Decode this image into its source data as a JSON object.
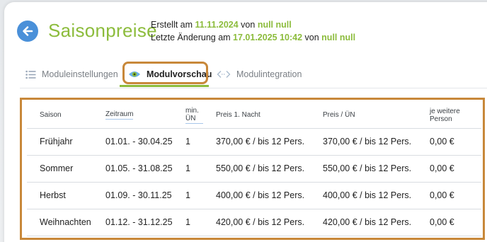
{
  "header": {
    "title": "Saisonpreise",
    "created_prefix": "Erstellt am ",
    "created_date": "11.11.2024",
    "created_by_prefix": " von ",
    "created_by": "null null",
    "changed_prefix": "Letzte Änderung am ",
    "changed_date": "17.01.2025 10:42",
    "changed_by_prefix": " von ",
    "changed_by": "null null"
  },
  "tabs": [
    {
      "label": "Moduleinstellungen",
      "icon": "list-icon",
      "active": false
    },
    {
      "label": "Modulvorschau",
      "icon": "eye-icon",
      "active": true
    },
    {
      "label": "Modulintegration",
      "icon": "code-icon",
      "active": false
    }
  ],
  "table": {
    "headers": [
      "Saison",
      "Zeitraum",
      "min. ÜN",
      "Preis 1. Nacht",
      "Preis / ÜN",
      "je weitere Person"
    ],
    "rows": [
      [
        "Frühjahr",
        "01.01. - 30.04.25",
        "1",
        "370,00 € / bis 12 Pers.",
        "370,00 € / bis 12 Pers.",
        "0,00 €"
      ],
      [
        "Sommer",
        "01.05. - 31.08.25",
        "1",
        "550,00 € / bis 12 Pers.",
        "550,00 € / bis 12 Pers.",
        "0,00 €"
      ],
      [
        "Herbst",
        "01.09. - 30.11.25",
        "1",
        "400,00 € / bis 12 Pers.",
        "400,00 € / bis 12 Pers.",
        "0,00 €"
      ],
      [
        "Weihnachten",
        "01.12. - 31.12.25",
        "1",
        "420,00 € / bis 12 Pers.",
        "420,00 € / bis 12 Pers.",
        "0,00 €"
      ]
    ]
  },
  "colors": {
    "accent_green": "#8cbc3c",
    "back_button_blue": "#4a90d9",
    "highlight_orange": "#c8883a"
  }
}
